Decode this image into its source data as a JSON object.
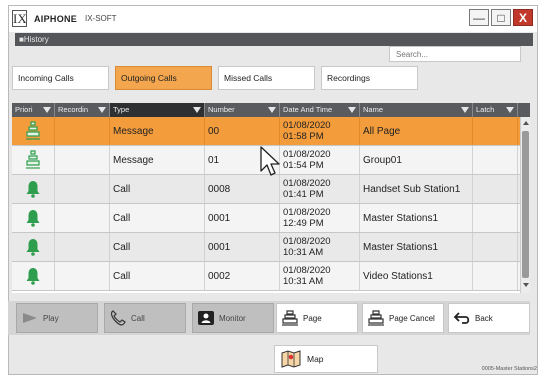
{
  "titlebar": {
    "logo_glyph": "IX",
    "brand": "AIPHONE",
    "product": "IX-SOFT",
    "minimize_glyph": "—",
    "maximize_glyph": "□",
    "close_glyph": "X"
  },
  "header": {
    "title": "■History"
  },
  "search": {
    "placeholder": "Search..."
  },
  "tabs": [
    {
      "label": "Incoming Calls",
      "active": false
    },
    {
      "label": "Outgoing Calls",
      "active": true
    },
    {
      "label": "Missed Calls",
      "active": false
    },
    {
      "label": "Recordings",
      "active": false
    }
  ],
  "table": {
    "columns": [
      "Priori",
      "Recordin",
      "Type",
      "Number",
      "Date And Time",
      "Name",
      "Latch"
    ],
    "rows": [
      {
        "priority_icon": "page-speaker-icon",
        "type": "Message",
        "number": "00",
        "date": "01/08/2020",
        "time": "01:58 PM",
        "name": "All Page",
        "selected": true
      },
      {
        "priority_icon": "page-speaker-icon",
        "type": "Message",
        "number": "01",
        "date": "01/08/2020",
        "time": "01:54 PM",
        "name": "Group01",
        "selected": false
      },
      {
        "priority_icon": "bell-icon",
        "type": "Call",
        "number": "0008",
        "date": "01/08/2020",
        "time": "01:41 PM",
        "name": "Handset Sub Station1",
        "selected": false
      },
      {
        "priority_icon": "bell-icon",
        "type": "Call",
        "number": "0001",
        "date": "01/08/2020",
        "time": "12:49 PM",
        "name": "Master Stations1",
        "selected": false
      },
      {
        "priority_icon": "bell-icon",
        "type": "Call",
        "number": "0001",
        "date": "01/08/2020",
        "time": "10:31 AM",
        "name": "Master Stations1",
        "selected": false
      },
      {
        "priority_icon": "bell-icon",
        "type": "Call",
        "number": "0002",
        "date": "01/08/2020",
        "time": "10:31 AM",
        "name": "Video Stations1",
        "selected": false
      }
    ]
  },
  "buttons": {
    "play": "Play",
    "call": "Call",
    "monitor": "Monitor",
    "page": "Page",
    "page_cancel": "Page Cancel",
    "back": "Back",
    "map": "Map"
  },
  "station_label": "0005-Master Stations2",
  "colors": {
    "accent_orange": "#f39c3c",
    "priority_green": "#2e9e4e",
    "header_dark": "#555659"
  }
}
